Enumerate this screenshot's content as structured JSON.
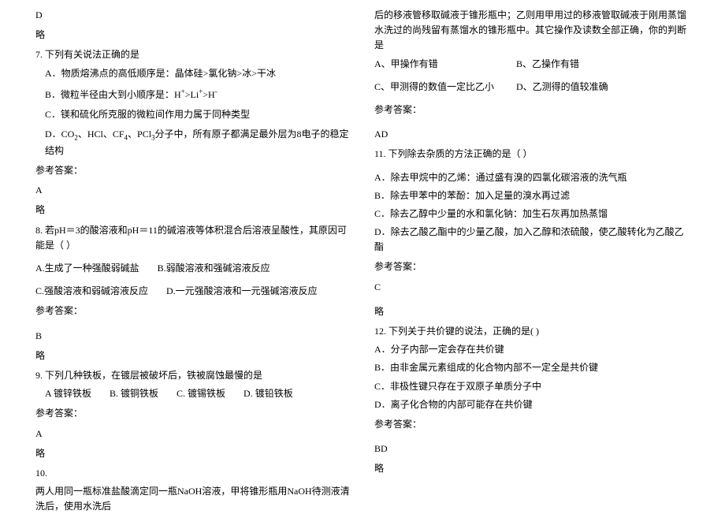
{
  "col1": {
    "pre_ans": "D",
    "pre_note": "略",
    "q7": {
      "stem": "7. 下列有关说法正确的是",
      "A": "A．物质熔沸点的高低顺序是：晶体硅>氯化钠>冰>干冰",
      "B_pre": "B．微粒半径由大到小顺序是：H",
      "B_mid": ">Li",
      "B_end": ">H",
      "C": "C．镁和硫化所克服的微粒间作用力属于同种类型",
      "D_pre": "D．CO",
      "D_2": "、HCl、CF",
      "D_3": "、PCl",
      "D_4": "分子中，所有原子都满足最外层为8电子的稳定结构",
      "ans_head": "参考答案：",
      "ans": "A",
      "note": "略"
    },
    "q8": {
      "stem": "8. 若pH＝3的酸溶液和pH＝11的碱溶液等体积混合后溶液呈酸性，其原因可能是（  ）",
      "A": "A.生成了一种强酸弱碱盐",
      "B": "B.弱酸溶液和强碱溶液反应",
      "C": "C.强酸溶液和弱碱溶液反应",
      "D": "D.一元强酸溶液和一元强碱溶液反应",
      "ans_head": "参考答案：",
      "ans": "B",
      "note": "略"
    },
    "q9": {
      "stem": "9. 下列几种铁板，在镀层被破坏后，铁被腐蚀最慢的是",
      "A": "A 镀锌铁板",
      "B": "B. 镀铜铁板",
      "C": "C. 镀锡铁板",
      "D": "D. 镀铅铁板",
      "ans_head": "参考答案：",
      "ans": "A",
      "note": "略"
    },
    "q10": {
      "num": "10.",
      "stem": "两人用同一瓶标准盐酸滴定同一瓶NaOH溶液，甲将锥形瓶用NaOH待测液清洗后，使用水洗后"
    }
  },
  "col2": {
    "q10_cont1": "后的移液管移取碱液于锥形瓶中；乙则用甲用过的移液管取碱液于刚用蒸馏水洗过的尚残留有蒸馏水的锥形瓶中。其它操作及读数全部正确，你的判断是",
    "q10_A": "A、甲操作有错",
    "q10_B": "B、乙操作有错",
    "q10_C": "C、甲测得的数值一定比乙小",
    "q10_D": "D、乙测得的值较准确",
    "q10_ans_head": "参考答案：",
    "q10_ans": "AD",
    "q11": {
      "stem": "11. 下列除去杂质的方法正确的是（    ）",
      "A": "A．除去甲烷中的乙烯：通过盛有溴的四氯化碳溶液的洗气瓶",
      "B": "B．除去甲苯中的苯酚：加入足量的溴水再过滤",
      "C": "C．除去乙醇中少量的水和氯化钠：加生石灰再加热蒸馏",
      "D": "D．除去乙酸乙酯中的少量乙酸，加入乙醇和浓硫酸，使乙酸转化为乙酸乙酯",
      "ans_head": "参考答案：",
      "ans": "C",
      "note": "略"
    },
    "q12": {
      "stem": "12. 下列关于共价键的说法，正确的是(       )",
      "A": "A．分子内部一定会存在共价键",
      "B": "B．由非金属元素组成的化合物内部不一定全是共价键",
      "C": "C．非极性键只存在于双原子单质分子中",
      "D": "D．离子化合物的内部可能存在共价键",
      "ans_head": "参考答案：",
      "ans": "BD",
      "note": "略"
    }
  }
}
